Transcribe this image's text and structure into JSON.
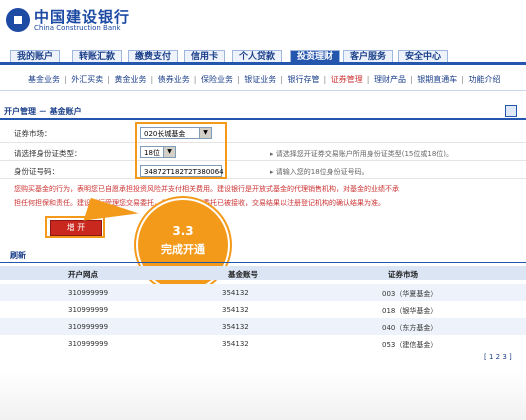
{
  "brand": {
    "name_cn": "中国建设银行",
    "name_en": "China Construction Bank"
  },
  "top_tabs": [
    "我的账户",
    "转账汇款",
    "缴费支付",
    "信用卡",
    "个人贷款",
    "投资理财",
    "客户服务",
    "安全中心"
  ],
  "top_tab_active": "投资理财",
  "sub_nav": [
    "基金业务",
    "外汇买卖",
    "黄金业务",
    "债券业务",
    "保险业务",
    "银证业务",
    "银行存管",
    "证券管理",
    "理财产品",
    "银期直通车",
    "功能介绍"
  ],
  "sub_nav_active": "证券管理",
  "section_title": "开户管理 － 基金账户",
  "form": {
    "market_label": "证券市场：",
    "market_value": "020长城基金",
    "id_type_label": "请选择身份证类型：",
    "id_type_value": "18位",
    "id_type_hint": "请选择您开证券交易账户所用身份证类型(15位或18位)。",
    "id_number_label": "身份证号码：",
    "id_number_value": "34872T182T2T380064",
    "id_number_hint": "请输入您的18位身份证号码。",
    "warning_line1": "您购买基金的行为，表明您已自愿承担投资风险并支付相关费用。建设银行是开放式基金的代理销售机构，对基金的业绩不承",
    "warning_line2": "担任何担保和责任。建设银行受理您交易委托，仅表明您交易委托已被接收，交易结果以注册登记机构的确认结果为准。",
    "open_button": "增 开"
  },
  "callout": {
    "step": "3.3",
    "text": "完成开通"
  },
  "table": {
    "title": "刷新",
    "headers": [
      "开户网点",
      "基金账号",
      "证券市场"
    ],
    "rows": [
      [
        "310999999",
        "354132",
        "003（华夏基金）"
      ],
      [
        "310999999",
        "354132",
        "018（银华基金）"
      ],
      [
        "310999999",
        "354132",
        "040（东方基金）"
      ],
      [
        "310999999",
        "354132",
        "053（建信基金）"
      ]
    ],
    "pager": "[ 1 2 3 ]"
  },
  "colors": {
    "brand_blue": "#1d4aa3",
    "nav_blue": "#2556ad",
    "accent_orange": "#f39a1a",
    "button_red": "#c9281f",
    "warn_red": "#cc3333"
  }
}
